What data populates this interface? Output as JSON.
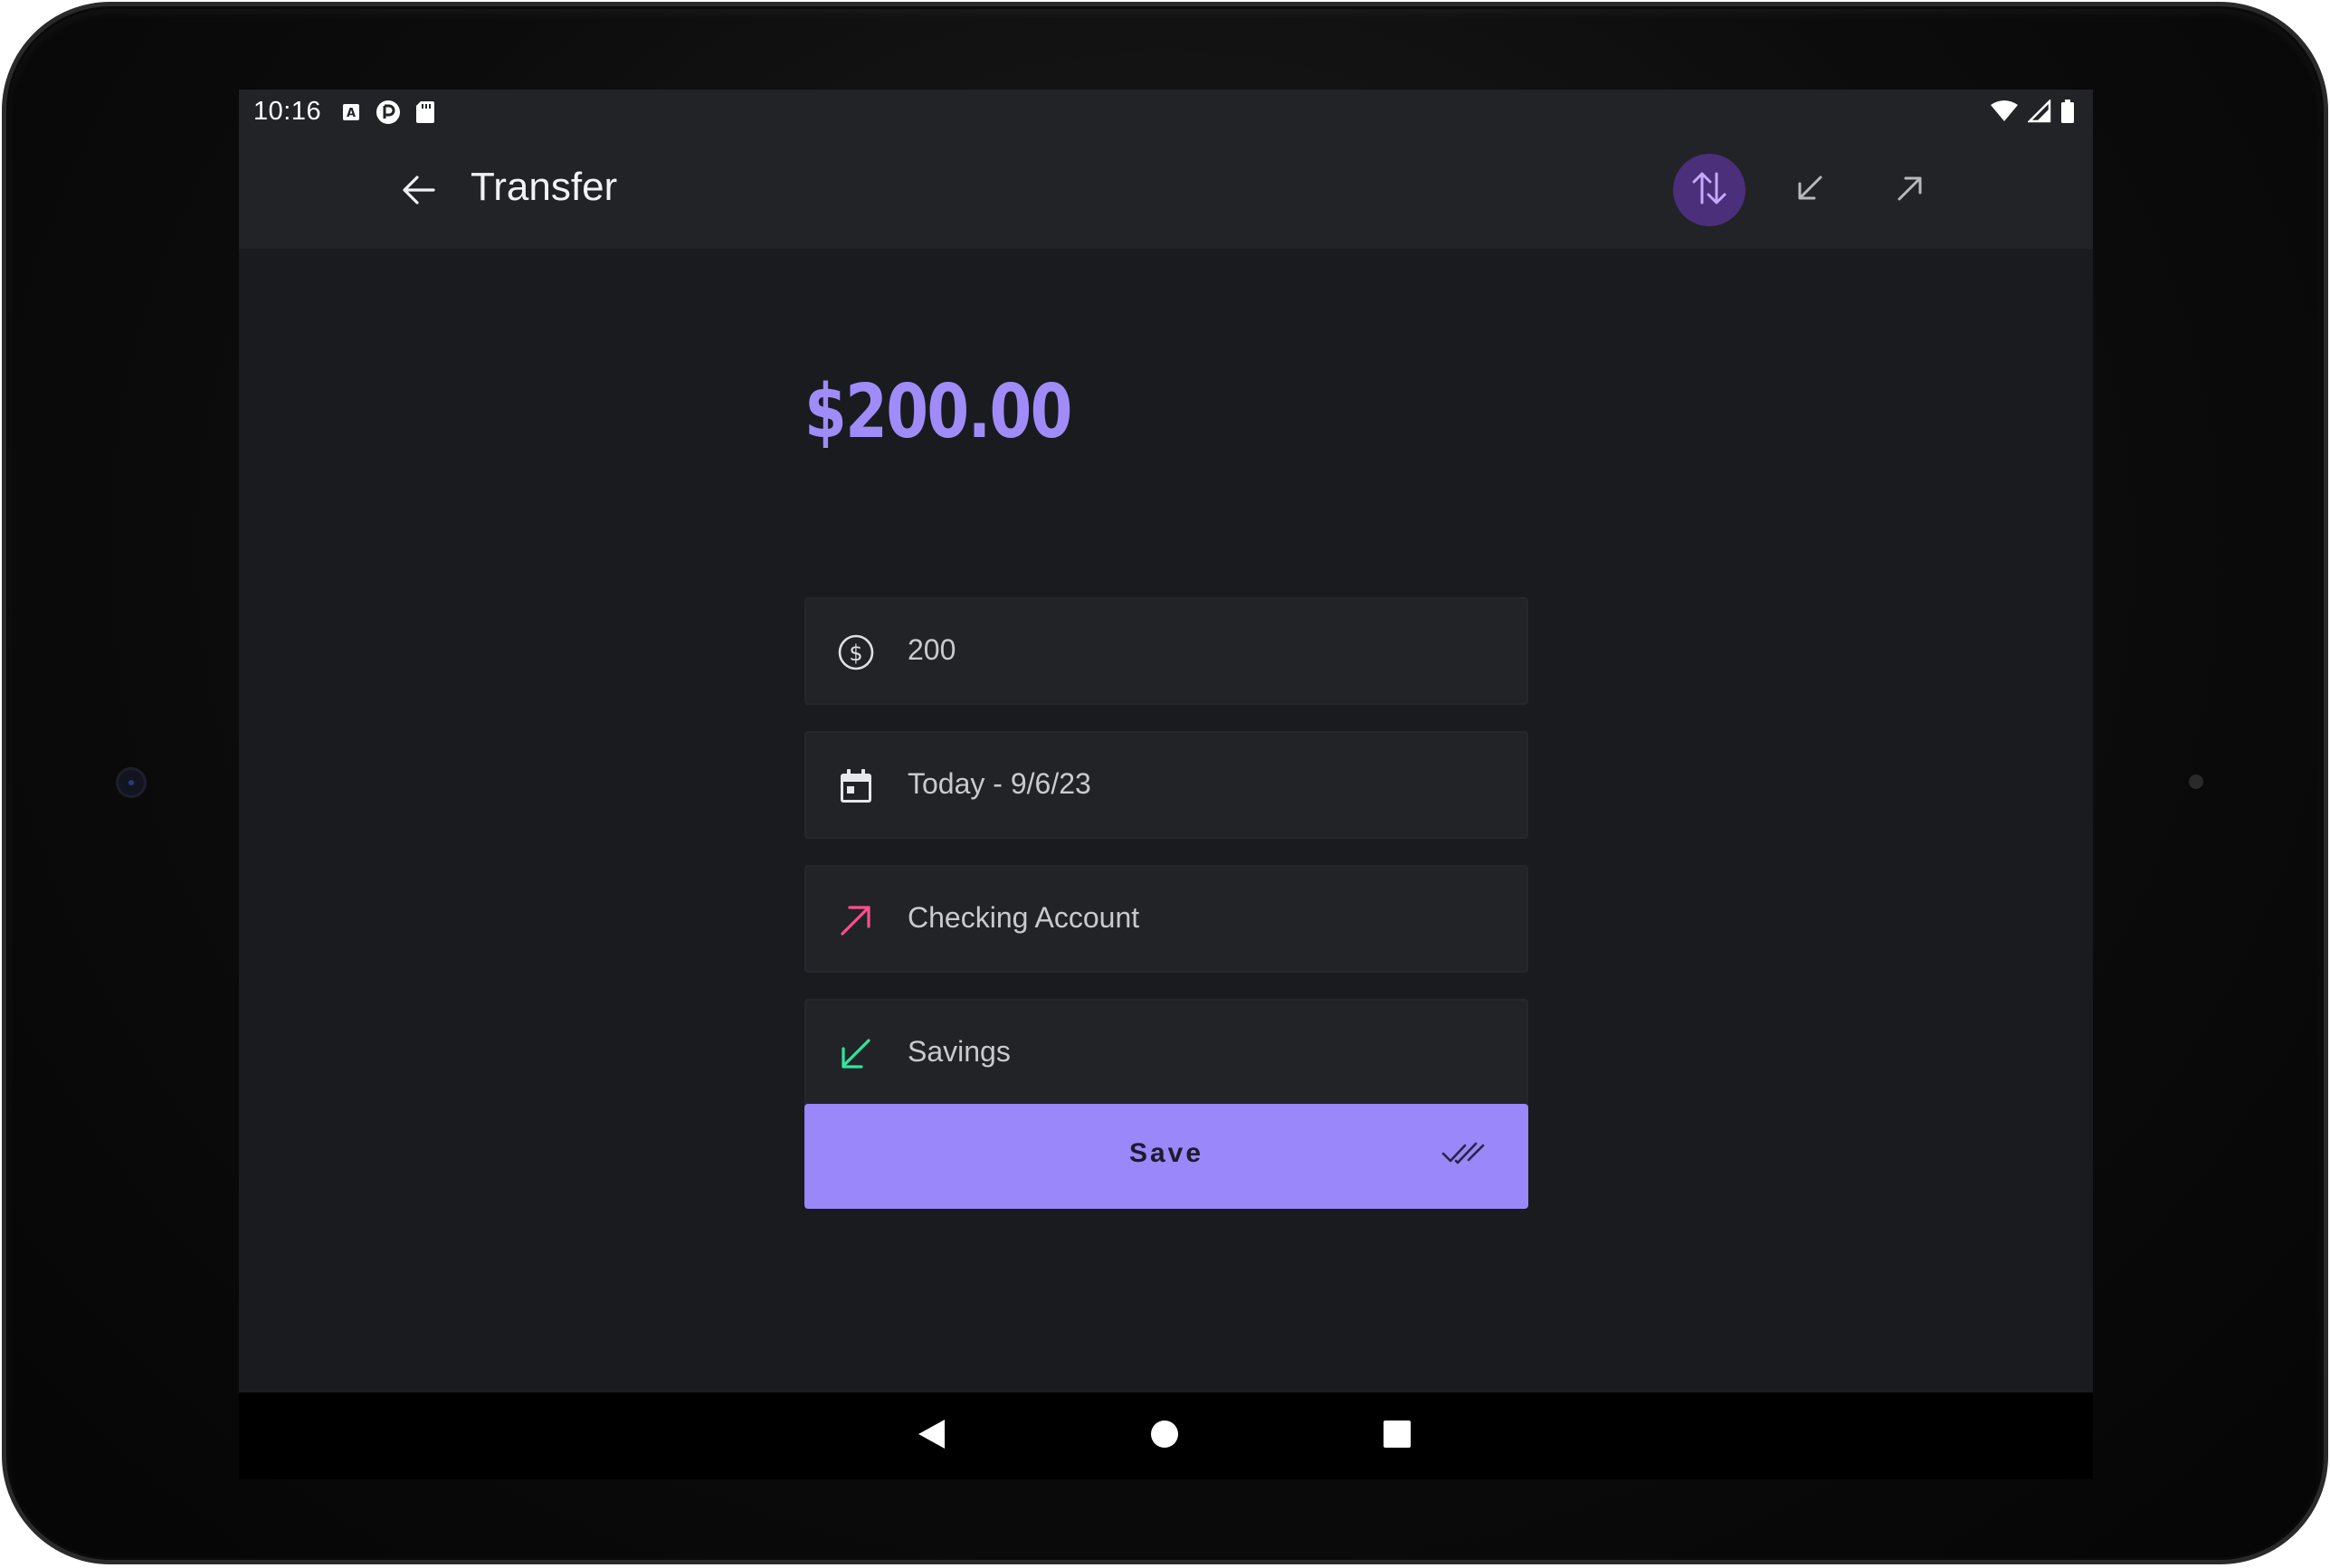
{
  "status_bar": {
    "time": "10:16",
    "left_icons": [
      "autofill-a-icon",
      "pocket-casts-icon",
      "sd-card-icon"
    ],
    "right_icons": [
      "wifi-icon",
      "cell-signal-icon",
      "battery-icon"
    ]
  },
  "app_bar": {
    "title": "Transfer",
    "back_icon": "arrow-left-icon",
    "type_buttons": [
      {
        "name": "transfer",
        "icon": "swap-vertical-icon",
        "active": true
      },
      {
        "name": "income",
        "icon": "arrow-down-left-icon",
        "active": false
      },
      {
        "name": "expense",
        "icon": "arrow-up-right-icon",
        "active": false
      }
    ]
  },
  "form": {
    "amount_display": "$200.00",
    "fields": [
      {
        "name": "amount",
        "icon": "dollar-circle-icon",
        "value": "200"
      },
      {
        "name": "date",
        "icon": "calendar-icon",
        "value": "Today - 9/6/23"
      },
      {
        "name": "from-account",
        "icon": "arrow-up-right-icon",
        "value": "Checking Account",
        "icon_color": "#ff4f8b"
      },
      {
        "name": "to-account",
        "icon": "arrow-down-left-icon",
        "value": "Savings",
        "icon_color": "#2ee6a0"
      }
    ],
    "save_label": "Save",
    "save_icon": "double-check-icon"
  },
  "nav_bar": {
    "buttons": [
      "back-triangle-icon",
      "home-circle-icon",
      "recents-square-icon"
    ]
  },
  "colors": {
    "accent": "#9a87f9",
    "amount": "#a08cf8",
    "background": "#1a1b1f",
    "surface": "#222327",
    "active_chip": "#4b2f7a"
  }
}
